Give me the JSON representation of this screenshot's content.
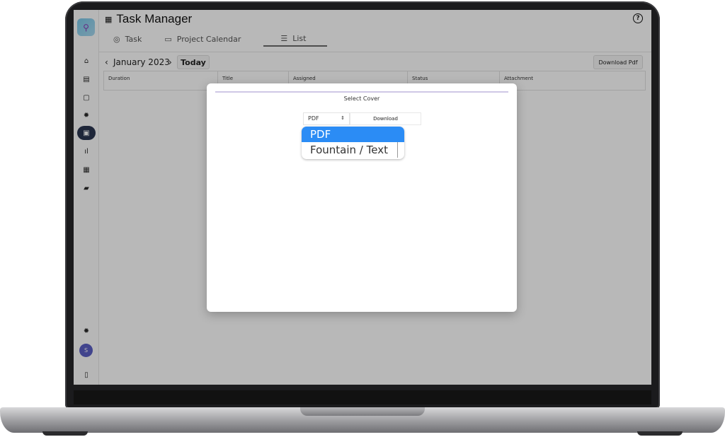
{
  "app": {
    "title": "Task Manager",
    "help_icon": "?",
    "logo_icon": "magnifier-logo"
  },
  "tabs": [
    {
      "label": "Task",
      "icon": "task-check-icon"
    },
    {
      "label": "Project Calendar",
      "icon": "calendar-icon"
    },
    {
      "label": "List",
      "icon": "list-icon",
      "active": true
    }
  ],
  "toolbar": {
    "prev": "‹",
    "next": "›",
    "month": "January 2023",
    "today_label": "Today",
    "download_pdf_label": "Download Pdf"
  },
  "table": {
    "columns": [
      "Duration",
      "Title",
      "Assigned",
      "Status",
      "Attachment"
    ]
  },
  "sidebar": {
    "avatar_letter": "S"
  },
  "modal": {
    "title": "Select Cover",
    "select_value": "PDF",
    "select_arrow": "⇕",
    "download_label": "Download",
    "options": [
      "PDF",
      "Fountain / Text"
    ]
  },
  "colors": {
    "accent_blue": "#2b8cf5",
    "nav_active": "#2a3550",
    "avatar": "#5a5fc4"
  }
}
